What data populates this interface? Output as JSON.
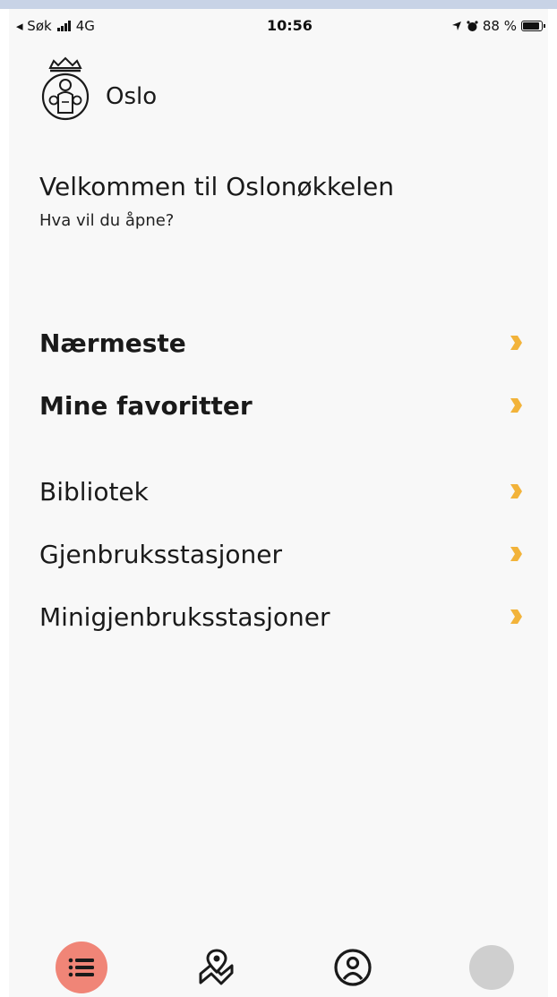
{
  "status_bar": {
    "back_label": "◂ Søk",
    "network": "4G",
    "time": "10:56",
    "battery_text": "88 %",
    "battery_level": 0.88
  },
  "header": {
    "app_name": "Oslo"
  },
  "welcome": {
    "title": "Velkommen til Oslonøkkelen",
    "subtitle": "Hva vil du åpne?"
  },
  "menu": {
    "items": [
      {
        "label": "Nærmeste",
        "bold": true
      },
      {
        "label": "Mine favoritter",
        "bold": true
      },
      {
        "label": "Bibliotek",
        "bold": false
      },
      {
        "label": "Gjenbruksstasjoner",
        "bold": false
      },
      {
        "label": "Minigjenbruksstasjoner",
        "bold": false
      }
    ]
  },
  "colors": {
    "chevron": "#f2b33a",
    "nav_active": "#f08577",
    "nav_inactive": "#cfcfcf"
  },
  "bottom_nav": {
    "items": [
      "list-icon",
      "map-icon",
      "profile-icon",
      "avatar"
    ]
  }
}
